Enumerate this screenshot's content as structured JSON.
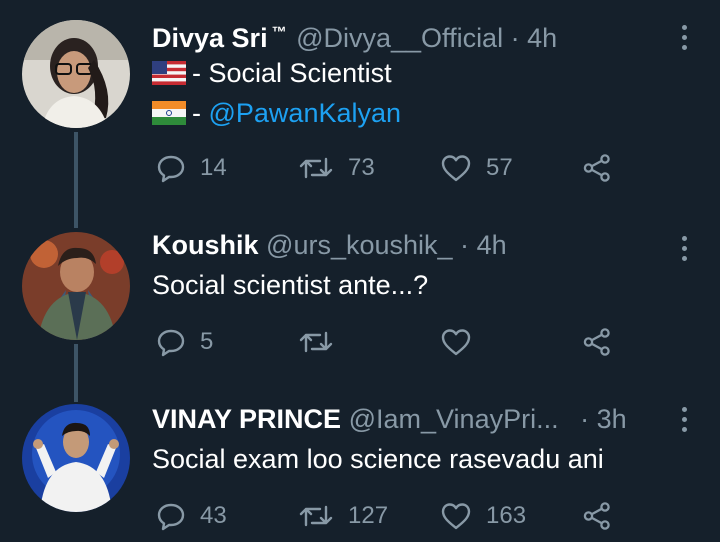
{
  "tweets": [
    {
      "name": "Divya Sri",
      "badge": "™",
      "handle": "@Divya__Official",
      "separator": "·",
      "time": "4h",
      "lines": [
        {
          "prefix": "- ",
          "text": "Social Scientist",
          "flag": "us-flag-icon"
        },
        {
          "prefix": "- ",
          "text": "@PawanKalyan",
          "flag": "india-flag-icon"
        }
      ],
      "replies": "14",
      "retweets": "73",
      "likes": "57"
    },
    {
      "name": "Koushik",
      "handle": "@urs_koushik_",
      "separator": "·",
      "time": "4h",
      "text": "Social scientist ante...?",
      "replies": "5",
      "retweets": "",
      "likes": ""
    },
    {
      "name": "VINAY PRINCE",
      "handle": "@Iam_VinayPri...",
      "separator": "·",
      "time": "3h",
      "text": "Social exam loo science rasevadu ani",
      "replies": "43",
      "retweets": "127",
      "likes": "163"
    }
  ],
  "colors": {
    "background": "#15202b",
    "muted": "#8899a6",
    "link": "#1da1f2",
    "thread": "#3d5466"
  }
}
